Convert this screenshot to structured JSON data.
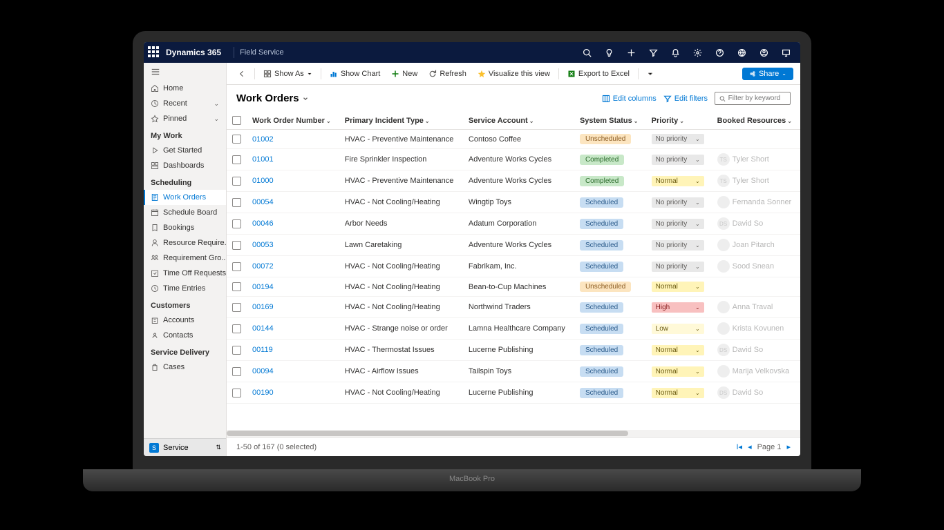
{
  "topbar": {
    "brand": "Dynamics 365",
    "app": "Field Service"
  },
  "sidebar": {
    "top": [
      {
        "label": "Home"
      },
      {
        "label": "Recent",
        "expand": true
      },
      {
        "label": "Pinned",
        "expand": true
      }
    ],
    "sections": [
      {
        "header": "My Work",
        "items": [
          {
            "label": "Get Started"
          },
          {
            "label": "Dashboards"
          }
        ]
      },
      {
        "header": "Scheduling",
        "items": [
          {
            "label": "Work Orders",
            "active": true
          },
          {
            "label": "Schedule Board"
          },
          {
            "label": "Bookings"
          },
          {
            "label": "Resource Require..."
          },
          {
            "label": "Requirement Gro..."
          },
          {
            "label": "Time Off Requests"
          },
          {
            "label": "Time Entries"
          }
        ]
      },
      {
        "header": "Customers",
        "items": [
          {
            "label": "Accounts"
          },
          {
            "label": "Contacts"
          }
        ]
      },
      {
        "header": "Service Delivery",
        "items": [
          {
            "label": "Cases"
          }
        ]
      }
    ],
    "area": "Service"
  },
  "cmdbar": {
    "showAs": "Show As",
    "showChart": "Show Chart",
    "new": "New",
    "refresh": "Refresh",
    "visualize": "Visualize this view",
    "export": "Export to Excel",
    "share": "Share"
  },
  "view": {
    "title": "Work Orders",
    "editColumns": "Edit columns",
    "editFilters": "Edit filters",
    "filterPlaceholder": "Filter by keyword"
  },
  "columns": [
    "Work Order Number",
    "Primary Incident Type",
    "Service Account",
    "System Status",
    "Priority",
    "Booked Resources"
  ],
  "rows": [
    {
      "num": "01002",
      "incident": "HVAC - Preventive Maintenance",
      "account": "Contoso Coffee",
      "status": "Unscheduled",
      "priority": "No priority",
      "resource": ""
    },
    {
      "num": "01001",
      "incident": "Fire Sprinkler Inspection",
      "account": "Adventure Works Cycles",
      "status": "Completed",
      "priority": "No priority",
      "resource": "Tyler Short",
      "initials": "TS"
    },
    {
      "num": "01000",
      "incident": "HVAC - Preventive Maintenance",
      "account": "Adventure Works Cycles",
      "status": "Completed",
      "priority": "Normal",
      "resource": "Tyler Short",
      "initials": "TS"
    },
    {
      "num": "00054",
      "incident": "HVAC - Not Cooling/Heating",
      "account": "Wingtip Toys",
      "status": "Scheduled",
      "priority": "No priority",
      "resource": "Fernanda Sonner",
      "initials": ""
    },
    {
      "num": "00046",
      "incident": "Arbor Needs",
      "account": "Adatum Corporation",
      "status": "Scheduled",
      "priority": "No priority",
      "resource": "David So",
      "initials": "DS"
    },
    {
      "num": "00053",
      "incident": "Lawn Caretaking",
      "account": "Adventure Works Cycles",
      "status": "Scheduled",
      "priority": "No priority",
      "resource": "Joan Pitarch",
      "initials": ""
    },
    {
      "num": "00072",
      "incident": "HVAC - Not Cooling/Heating",
      "account": "Fabrikam, Inc.",
      "status": "Scheduled",
      "priority": "No priority",
      "resource": "Sood Snean",
      "initials": ""
    },
    {
      "num": "00194",
      "incident": "HVAC - Not Cooling/Heating",
      "account": "Bean-to-Cup Machines",
      "status": "Unscheduled",
      "priority": "Normal",
      "resource": ""
    },
    {
      "num": "00169",
      "incident": "HVAC - Not Cooling/Heating",
      "account": "Northwind Traders",
      "status": "Scheduled",
      "priority": "High",
      "resource": "Anna Traval",
      "initials": ""
    },
    {
      "num": "00144",
      "incident": "HVAC - Strange noise or order",
      "account": "Lamna Healthcare Company",
      "status": "Scheduled",
      "priority": "Low",
      "resource": "Krista Kovunen",
      "initials": ""
    },
    {
      "num": "00119",
      "incident": "HVAC - Thermostat Issues",
      "account": "Lucerne Publishing",
      "status": "Scheduled",
      "priority": "Normal",
      "resource": "David So",
      "initials": "DS"
    },
    {
      "num": "00094",
      "incident": "HVAC - Airflow Issues",
      "account": "Tailspin Toys",
      "status": "Scheduled",
      "priority": "Normal",
      "resource": "Marija Velkovska",
      "initials": ""
    },
    {
      "num": "00190",
      "incident": "HVAC - Not Cooling/Heating",
      "account": "Lucerne Publishing",
      "status": "Scheduled",
      "priority": "Normal",
      "resource": "David So",
      "initials": "DS"
    }
  ],
  "footer": {
    "count": "1-50 of 167 (0 selected)",
    "page": "Page 1"
  }
}
